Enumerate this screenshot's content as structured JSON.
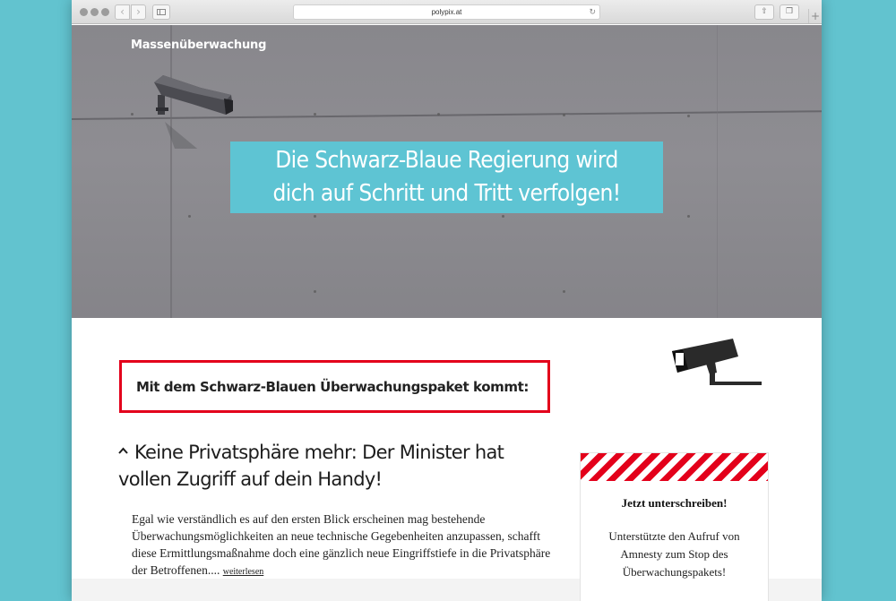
{
  "browser": {
    "url": "polypix.at",
    "back_icon": "chevron-left-icon",
    "forward_icon": "chevron-right-icon"
  },
  "hero": {
    "site_title": "Massenüberwachung",
    "headline_line1": "Die Schwarz-Blaue Regierung wird",
    "headline_line2": "dich auf Schritt und Tritt verfolgen!",
    "headline_bg": "#5ec4d3"
  },
  "main": {
    "intro_box_text": "Mit dem Schwarz-Blauen Überwachungspaket kommt:",
    "intro_box_border": "#e3001b",
    "section_heading_line1": "Keine Privatsphäre mehr: Der Minister hat",
    "section_heading_line2": "vollen Zugriff auf dein Handy!",
    "body_line1": "Egal wie verständlich es auf den ersten Blick erscheinen mag bestehende",
    "body_line2": "Überwachungsmöglichkeiten an neue technische Gegebenheiten anzupassen, schafft",
    "body_line3": "diese Ermittlungsmaßnahme doch eine gänzlich neue Eingriffstiefe in die Privatsphäre",
    "body_line4": "der Betroffenen....",
    "read_more": "weiterlesen"
  },
  "sidebar": {
    "petition_title": "Jetzt unterschreiben!",
    "petition_line1": "Unterstützte den Aufruf von",
    "petition_line2": "Amnesty zum Stop des",
    "petition_line3": "Überwachungspakets!"
  }
}
